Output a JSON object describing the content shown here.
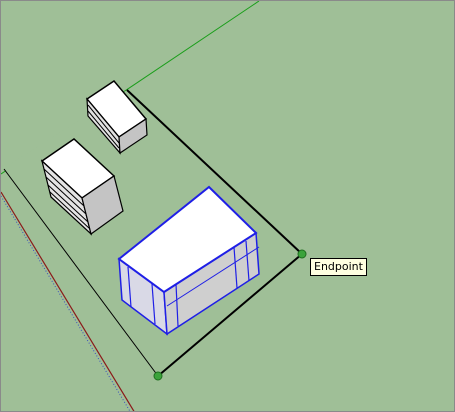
{
  "viewport": {
    "background_color": "#9fbf97",
    "inference_tooltip": "Endpoint"
  },
  "axes": {
    "green_axis_color": "#1a9e1a",
    "red_axis_color": "#8b1a1a",
    "blue_axis_color": "#3a4fbf"
  },
  "objects": {
    "selected_table": {
      "selected": true,
      "highlight_color": "#1f1fe6"
    },
    "cabinet_small": {
      "selected": false
    },
    "cabinet_large": {
      "selected": false
    }
  },
  "endpoint_marker_color": "#3ba33b"
}
